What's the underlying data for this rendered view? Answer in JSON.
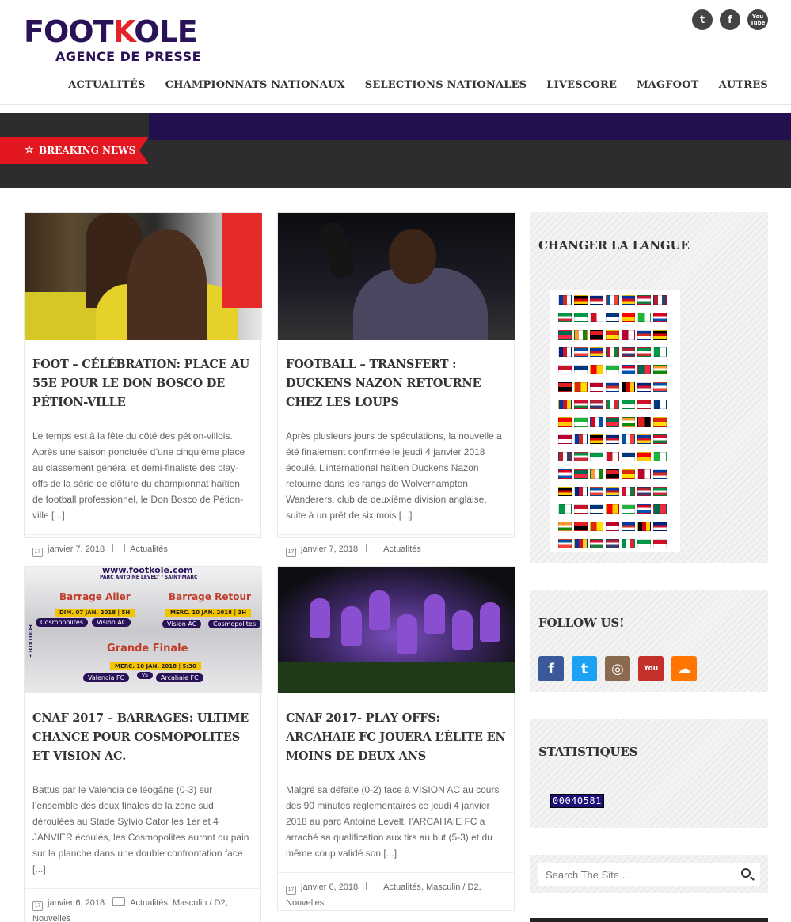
{
  "logo": {
    "main_before": "FOOT",
    "main_x": "K",
    "main_after": "OLE",
    "sub": "AGENCE DE PRESSE"
  },
  "social": {
    "twitter": "t",
    "facebook": "f",
    "youtube": "You Tube"
  },
  "nav": [
    "ACTUALITÉS",
    "CHAMPIONNATS NATIONAUX",
    "SELECTIONS NATIONALES",
    "LIVESCORE",
    "MAGFOOT",
    "AUTRES"
  ],
  "breaking": {
    "label": "BREAKING NEWS"
  },
  "posts": [
    {
      "title": "FOOT – CÉLÉBRATION: PLACE AU 55e POUR LE DON BOSCO DE PÉTION-VILLE",
      "excerpt": "Le temps est à la fête du côté des pétion-villois. Après une saison ponctuée d’une cinquième place au classement général et demi-finaliste des play-offs de la série de clôture du championnat haïtien de football professionnel, le Don Bosco de Pétion-ville [...]",
      "date": "janvier 7, 2018",
      "categories": "Actualités"
    },
    {
      "title": "FOOTBALL – TRANSFERT : DUCKENS NAZON RETOURNE CHEZ LES LOUPS",
      "excerpt": "Après plusieurs jours de spéculations, la nouvelle a été finalement confirmée le jeudi 4 janvier 2018 écoulé. L’international haïtien Duckens Nazon retourne dans les rangs de Wolverhampton Wanderers, club de deuxième division anglaise, suite à un prêt de six mois [...]",
      "date": "janvier 7, 2018",
      "categories": "Actualités"
    },
    {
      "title": "CNAF 2017 – BARRAGES: ULTIME CHANCE POUR COSMOPOLITES ET VISION AC.",
      "excerpt": "Battus par le Valencia de léogâne (0-3) sur l’ensemble des deux finales de la zone sud déroulées au Stade Sylvio Cator les 1er et 4 JANVIER écoulés, les Cosmopolites auront du pain sur la planche dans une double confrontation face [...]",
      "date": "janvier 6, 2018",
      "categories": "Actualités, Masculin / D2, Nouvelles"
    },
    {
      "title": "CNAF 2017- PLAY OFFS: ARCAHAIE FC JOUERA L’ÉLITE EN MOINS DE DEUX ANS",
      "excerpt": "Malgré sa défaite (0-2) face à VISION AC au cours des 90 minutes réglementaires ce jeudi 4 janvier 2018 au parc Antoine Levelt, l’ARCAHAIE FC a arraché sa qualification aux tirs au but (5-3) et du même coup validé son [...]",
      "date": "janvier 6, 2018",
      "categories": "Actualités, Masculin / D2, Nouvelles"
    }
  ],
  "poster": {
    "site": "www.footkole.com",
    "venue": "PARC ANTOINE LEVELT / SAINT-MARC",
    "brand": "FOOTKOLE",
    "aller_title": "Barrage Aller",
    "aller_date": "DIM. 07 JAN. 2018 | 5H",
    "aller_home": "Cosmopolites",
    "aller_away": "Vision AC",
    "retour_title": "Barrage Retour",
    "retour_date": "MERC. 10 JAN. 2018 | 3H",
    "retour_home": "Vision AC",
    "retour_away": "Cosmopolites",
    "finale_title": "Grande Finale",
    "finale_date": "MERC. 10 JAN. 2018 | 5:30",
    "finale_home": "Valencia FC",
    "finale_away": "Arcahaie FC",
    "vs": "VS"
  },
  "sidebar": {
    "language_title": "CHANGER LA LANGUE",
    "follow_title": "FOLLOW US!",
    "follow_icons": [
      "f",
      "t",
      "◎",
      "You",
      "☁"
    ],
    "stats_title": "STATISTIQUES",
    "counter": "00040581",
    "search_placeholder": "Search The Site ..."
  },
  "colors": {
    "brand": "#2a1259",
    "accent": "#e3171f",
    "bar": "#2d2d2d",
    "bar_top": "#22104f"
  }
}
